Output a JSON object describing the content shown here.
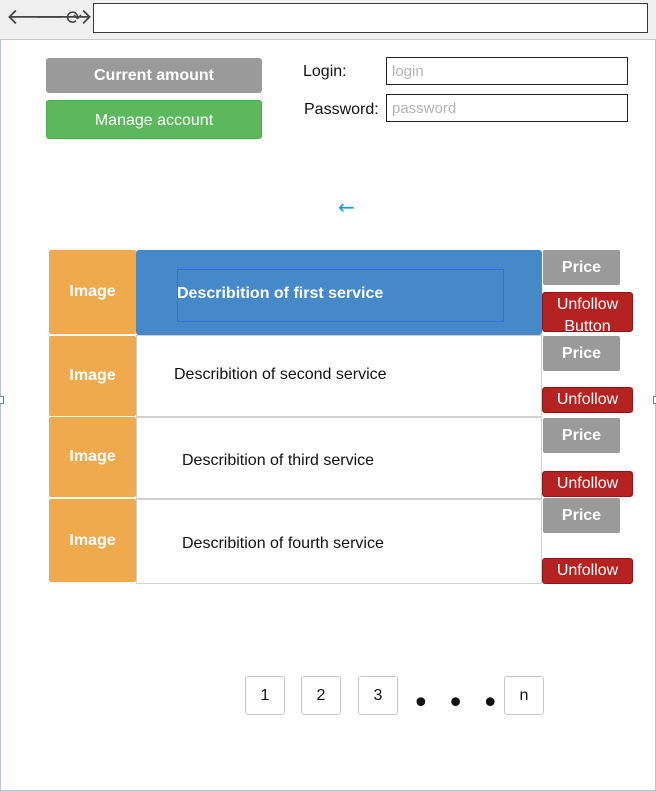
{
  "browser": {
    "back_glyph": "🡐",
    "forward_glyph": "🡒",
    "reload_glyph": "⟳",
    "address_value": "",
    "icons": {
      "back": "back-arrow-icon",
      "forward": "forward-arrow-icon",
      "reload": "reload-icon"
    }
  },
  "account": {
    "current_amount_label": "Current amount",
    "manage_account_label": "Manage account"
  },
  "auth": {
    "login_label": "Login:",
    "login_placeholder": "login",
    "password_label": "Password:",
    "password_placeholder": "password"
  },
  "back_link": {
    "glyph": "←",
    "icon": "arrow-left-icon"
  },
  "services": [
    {
      "image_label": "Image",
      "description": "Describition of first service",
      "price_label": "Price",
      "unfollow_label": "Unfollow Button",
      "selected": true
    },
    {
      "image_label": "Image",
      "description": "Describition of second service",
      "price_label": "Price",
      "unfollow_label": "Unfollow",
      "selected": false
    },
    {
      "image_label": "Image",
      "description": "Describition of third service",
      "price_label": "Price",
      "unfollow_label": "Unfollow",
      "selected": false
    },
    {
      "image_label": "Image",
      "description": "Describition of fourth service",
      "price_label": "Price",
      "unfollow_label": "Unfollow",
      "selected": false
    }
  ],
  "pagination": {
    "pages": [
      "1",
      "2",
      "3"
    ],
    "ellipsis": "•••",
    "last": "n"
  },
  "colors": {
    "image_tile": "#eeaa4d",
    "selected_row": "#4689c9",
    "price_button": "#9a9a9a",
    "unfollow_button": "#b52222",
    "manage_button": "#5cb85c",
    "back_arrow": "#1a9bd7"
  }
}
